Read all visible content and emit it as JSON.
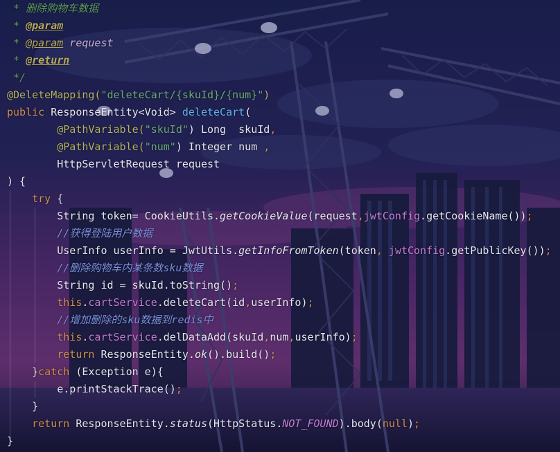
{
  "theme": {
    "background": "#15163a",
    "comment": "#6fa36b",
    "keyword": "#cf8e4e",
    "string": "#6aab73",
    "annotation": "#b1b35f",
    "field": "#c67bd4",
    "line_comment": "#7a8fdc"
  },
  "code": {
    "l1": {
      "a": " * 删除购物车数据"
    },
    "l2": {
      "a": " * ",
      "b": "@param"
    },
    "l3": {
      "a": " * ",
      "b": "@param",
      "c": " request"
    },
    "l4": {
      "a": " * ",
      "b": "@return"
    },
    "l5": {
      "a": " */"
    },
    "l6": {
      "a": "@DeleteMapping(",
      "b": "\"deleteCart/{skuId}/{num}\"",
      "c": ")"
    },
    "l7": {
      "a": "public",
      "b": " ResponseEntity<Void> ",
      "c": "deleteCart",
      "d": "("
    },
    "l8": {
      "a": "        ",
      "b": "@PathVariable(",
      "c": "\"skuId\"",
      "d": ") Long  skuId",
      ",": ","
    },
    "l9": {
      "a": "        ",
      "b": "@PathVariable(",
      "c": "\"num\"",
      "d": ") Integer num ",
      "e": ","
    },
    "l10": {
      "a": "        HttpServletRequest request"
    },
    "l11": {
      "a": ") {"
    },
    "l12": {
      "a": "    ",
      "b": "try",
      " ": " {"
    },
    "l13": {
      "a": "        String token= CookieUtils.",
      "b": "getCookieValue",
      "c": "(request",
      ",": ",",
      "d": "jwtConfig",
      ".": ".getCookieName())",
      ";": ";"
    },
    "l14": {
      "a": "        ",
      "b": "//获得登陆用户数据"
    },
    "l15": {
      "a": "        UserInfo userInfo = JwtUtils.",
      "b": "getInfoFromToken",
      "c": "(token",
      ",": ", ",
      "d": "jwtConfig",
      ".": ".getPublicKey())",
      ";": ";"
    },
    "l16": {
      "a": "        ",
      "b": "//删除购物车内某条数",
      "c": "sku",
      "d": "数据"
    },
    "l17": {
      "a": "        String id = skuId.toString()",
      ";": ";"
    },
    "l18": {
      "a": "        ",
      "b": "this",
      ".": ".",
      "c": "cartService",
      ".2": ".deleteCart(id",
      ",": ",",
      "d": "userInfo)",
      ";": ";"
    },
    "l19": {
      "a": "        ",
      "b": "//增加删除的",
      "c": "sku",
      "d": "数据到",
      "e": "redis",
      "f": "中"
    },
    "l20": {
      "a": "        ",
      "b": "this",
      ".": ".",
      "c": "cartService",
      ".2": ".delDataAdd(skuId",
      ",": ",",
      "d": "num",
      ",2": ",",
      "e": "userInfo)",
      ";": ";"
    },
    "l21": {
      "a": "        ",
      "b": "return",
      " ": " ResponseEntity.",
      "c": "ok",
      "d": "().build()",
      ";": ";"
    },
    "l22": {
      "a": "    }",
      "b": "catch",
      " ": " (Exception e){"
    },
    "l23": {
      "a": "        e.printStackTrace()",
      ";": ";"
    },
    "l24": {
      "a": "    }"
    },
    "l25": {
      "a": "    ",
      "b": "return",
      " ": " ResponseEntity.",
      "c": "status",
      "d": "(HttpStatus.",
      "e": "NOT_FOUND",
      "f": ").body(",
      "g": "null",
      "h": ")",
      ";": ";"
    },
    "l26": {
      "a": "}"
    }
  }
}
